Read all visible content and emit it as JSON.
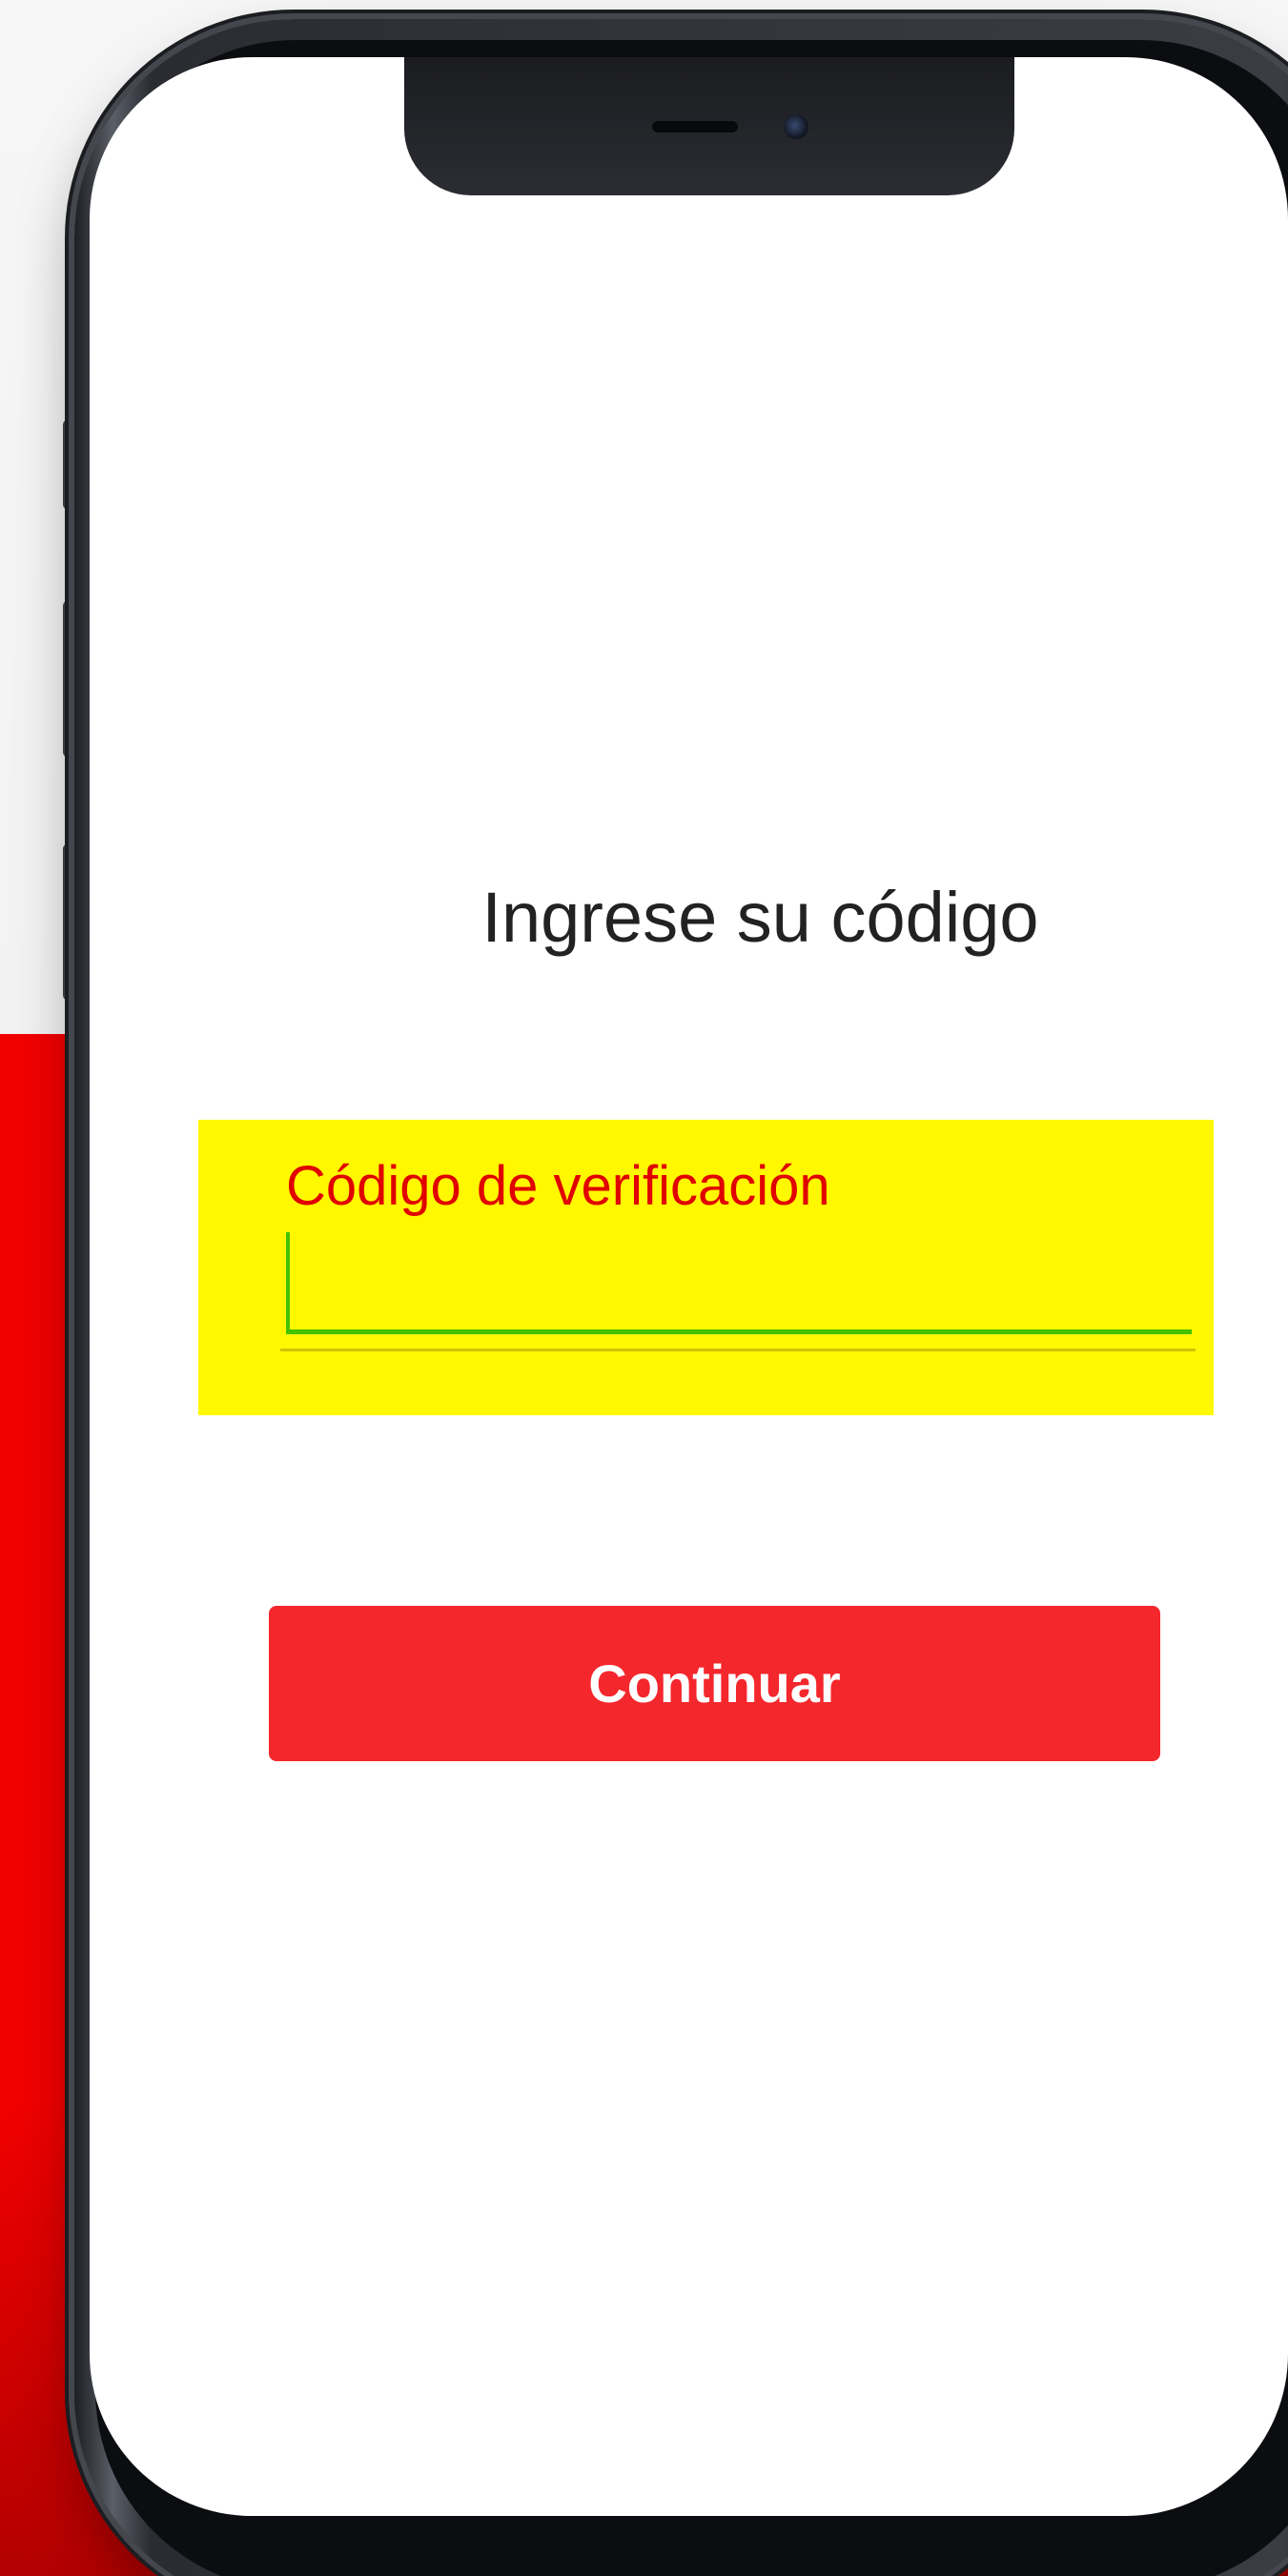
{
  "screen": {
    "title": "Ingrese su código",
    "verification_field": {
      "label": "Código de verificación",
      "value": ""
    },
    "continue_label": "Continuar"
  },
  "colors": {
    "accent_red": "#f4272d",
    "background_red": "#f20000",
    "highlight_yellow": "#fff800",
    "focus_green": "#44c200"
  }
}
